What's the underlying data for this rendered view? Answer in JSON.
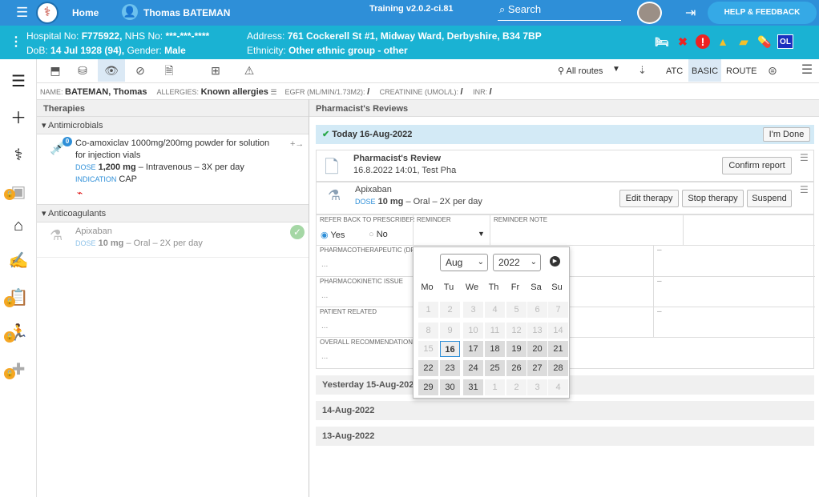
{
  "topbar": {
    "home": "Home",
    "patient": "Thomas BATEMAN",
    "training": "Training v2.0.2-ci.81",
    "search": "Search",
    "help": "HELP & FEEDBACK"
  },
  "patient": {
    "hospital_label": "Hospital No:",
    "hospital_no": "F775922,",
    "nhs_label": "NHS No:",
    "nhs_no": "***-***-****",
    "dob_label": "DoB:",
    "dob": "14 Jul 1928 (94),",
    "gender_label": "Gender:",
    "gender": "Male",
    "address_label": "Address:",
    "address": "761 Cockerell St #1, Midway Ward, Derbyshire, B34 7BP",
    "ethnicity_label": "Ethnicity:",
    "ethnicity": "Other ethnic group - other",
    "ol": "OL"
  },
  "toolbar": {
    "routes": "All routes",
    "tab_atc": "ATC",
    "tab_basic": "BASIC",
    "tab_route": "ROUTE"
  },
  "info": {
    "name_label": "NAME:",
    "name": "BATEMAN, Thomas",
    "allergies_label": "ALLERGIES:",
    "allergies": "Known allergies",
    "egfr_label": "EGFR (ML/MIN/1.73M2):",
    "egfr": "/",
    "creat_label": "CREATININE (UMOL/L):",
    "creat": "/",
    "inr_label": "INR:",
    "inr": "/"
  },
  "left": {
    "title": "Therapies",
    "group1": "Antimicrobials",
    "t1_name": "Co-amoxiclav 1000mg/200mg powder for solution for injection vials",
    "t1_dose_label": "DOSE",
    "t1_dose": "1,200 mg",
    "t1_dose_rest": "– Intravenous – 3X per day",
    "t1_ind_label": "INDICATION",
    "t1_ind": "CAP",
    "t1_badge": "0",
    "group2": "Anticoagulants",
    "t2_name": "Apixaban",
    "t2_dose_label": "DOSE",
    "t2_dose": "10 mg",
    "t2_dose_rest": "– Oral – 2X per day"
  },
  "right": {
    "title": "Pharmacist's Reviews",
    "today": "Today 16-Aug-2022",
    "done": "I'm Done",
    "review_title": "Pharmacist's Review",
    "review_meta": "16.8.2022 14:01, Test Pha",
    "confirm": "Confirm report",
    "drug": "Apixaban",
    "dose_label": "DOSE",
    "dose": "10 mg",
    "dose_rest": "– Oral – 2X per day",
    "edit": "Edit therapy",
    "stop": "Stop therapy",
    "suspend": "Suspend",
    "refer_label": "REFER BACK TO PRESCRIBER",
    "yes": "Yes",
    "no": "No",
    "reminder_label": "REMINDER",
    "reminder_note_label": "REMINDER NOTE",
    "pharmaco_label": "PHARMACOTHERAPEUTIC (DR",
    "kinetic_label": "PHARMACOKINETIC ISSUE",
    "patient_label": "PATIENT RELATED",
    "overall_label": "OVERALL RECOMMENDATION",
    "dots": "...",
    "dash": "–",
    "yesterday": "Yesterday 15-Aug-2022",
    "d14": "14-Aug-2022",
    "d13": "13-Aug-2022"
  },
  "calendar": {
    "month": "Aug",
    "year": "2022",
    "dow": [
      "Mo",
      "Tu",
      "We",
      "Th",
      "Fr",
      "Sa",
      "Su"
    ],
    "weeks": [
      [
        "1",
        "2",
        "3",
        "4",
        "5",
        "6",
        "7"
      ],
      [
        "8",
        "9",
        "10",
        "11",
        "12",
        "13",
        "14"
      ],
      [
        "15",
        "16",
        "17",
        "18",
        "19",
        "20",
        "21"
      ],
      [
        "22",
        "23",
        "24",
        "25",
        "26",
        "27",
        "28"
      ],
      [
        "29",
        "30",
        "31",
        "1",
        "2",
        "3",
        "4"
      ]
    ]
  }
}
